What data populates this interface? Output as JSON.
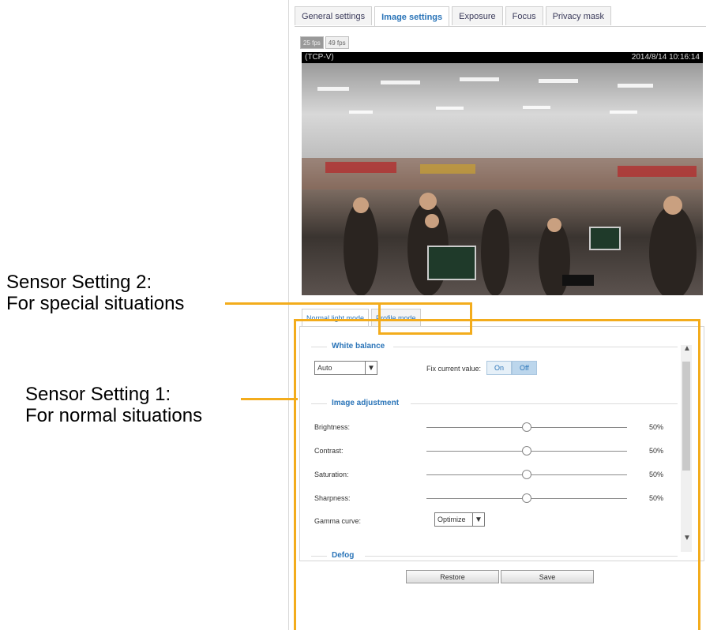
{
  "annotations": {
    "setting2_line1": "Sensor Setting 2:",
    "setting2_line2": "For special situations",
    "setting1_line1": "Sensor Setting 1:",
    "setting1_line2": "For normal situations",
    "highlight_color": "#f3ac1c"
  },
  "tabs": [
    "General settings",
    "Image settings",
    "Exposure",
    "Focus",
    "Privacy mask"
  ],
  "active_tab": "Image settings",
  "pager": [
    "25 fps",
    "49 fps"
  ],
  "video": {
    "stream_label": "(TCP-V)",
    "timestamp": "2014/8/14 10:16:14"
  },
  "sub_tabs": [
    "Normal light mode",
    "Profile mode"
  ],
  "white_balance": {
    "title": "White balance",
    "mode": "Auto",
    "fix_label": "Fix current value:",
    "on_label": "On",
    "off_label": "Off"
  },
  "image_adjustment": {
    "title": "Image adjustment",
    "sliders": [
      {
        "label": "Brightness:",
        "value": "50%",
        "level": 0.5
      },
      {
        "label": "Contrast:",
        "value": "50%",
        "level": 0.5
      },
      {
        "label": "Saturation:",
        "value": "50%",
        "level": 0.5
      },
      {
        "label": "Sharpness:",
        "value": "50%",
        "level": 0.5
      }
    ],
    "gamma_label": "Gamma curve:",
    "gamma_value": "Optimize"
  },
  "defog": {
    "title": "Defog"
  },
  "buttons": {
    "restore": "Restore",
    "save": "Save"
  }
}
